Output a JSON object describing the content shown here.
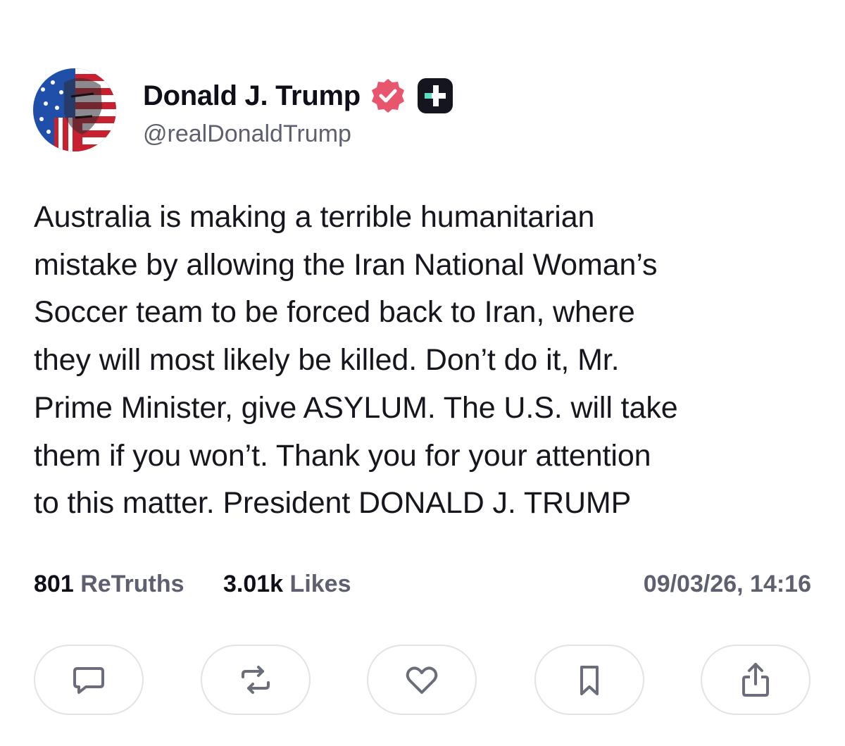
{
  "post": {
    "author": {
      "display_name": "Donald J. Trump",
      "handle": "@realDonaldTrump",
      "verified_icon": "verified-badge-icon",
      "plus_icon": "plus-badge-icon"
    },
    "text_lines": [
      "Australia is making a terrible humanitarian",
      "mistake by allowing the Iran National Woman’s",
      "Soccer team to be forced back to Iran, where",
      "they will most likely be killed. Don’t do it, Mr.",
      "Prime Minister, give ASYLUM. The U.S. will take",
      "them if you won’t. Thank you for your attention",
      "to this matter. President DONALD J. TRUMP"
    ],
    "stats": {
      "retruths_count": "801",
      "retruths_label": "ReTruths",
      "likes_count": "3.01k",
      "likes_label": "Likes"
    },
    "timestamp": "09/03/26, 14:16"
  },
  "actions": [
    {
      "icon": "reply-icon"
    },
    {
      "icon": "retruth-icon"
    },
    {
      "icon": "like-icon"
    },
    {
      "icon": "bookmark-icon"
    },
    {
      "icon": "share-icon"
    }
  ],
  "colors": {
    "text_primary": "#0f0f1a",
    "text_secondary": "#5e6070",
    "verified_pink": "#e8566e",
    "button_border": "#e2e3e8",
    "icon_gray": "#6b6d7a",
    "plus_badge_bg": "#14151f",
    "plus_badge_accent": "#58e0c0"
  }
}
